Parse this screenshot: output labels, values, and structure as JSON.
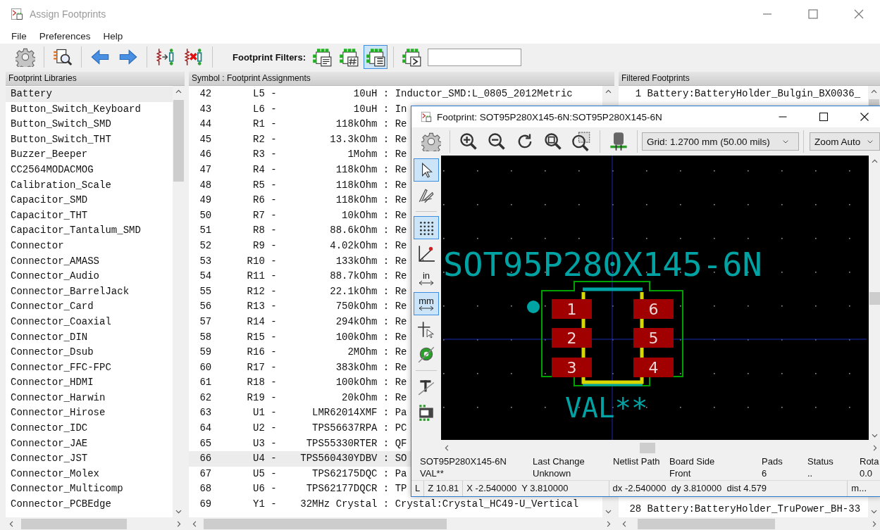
{
  "main_window": {
    "title": "Assign Footprints"
  },
  "menu": [
    "File",
    "Preferences",
    "Help"
  ],
  "toolbar": {
    "filters_label": "Footprint Filters:",
    "filters": [
      {
        "kind": "description",
        "selected": false
      },
      {
        "kind": "pin_count",
        "selected": false
      },
      {
        "kind": "library",
        "selected": true
      },
      {
        "kind": "text",
        "selected": false
      }
    ]
  },
  "libraries": {
    "header": "Footprint Libraries",
    "items": [
      {
        "name": "Battery",
        "selected": true
      },
      {
        "name": "Button_Switch_Keyboard",
        "selected": false
      },
      {
        "name": "Button_Switch_SMD",
        "selected": false
      },
      {
        "name": "Button_Switch_THT",
        "selected": false
      },
      {
        "name": "Buzzer_Beeper",
        "selected": false
      },
      {
        "name": "CC2564MODACMOG",
        "selected": false
      },
      {
        "name": "Calibration_Scale",
        "selected": false
      },
      {
        "name": "Capacitor_SMD",
        "selected": false
      },
      {
        "name": "Capacitor_THT",
        "selected": false
      },
      {
        "name": "Capacitor_Tantalum_SMD",
        "selected": false
      },
      {
        "name": "Connector",
        "selected": false
      },
      {
        "name": "Connector_AMASS",
        "selected": false
      },
      {
        "name": "Connector_Audio",
        "selected": false
      },
      {
        "name": "Connector_BarrelJack",
        "selected": false
      },
      {
        "name": "Connector_Card",
        "selected": false
      },
      {
        "name": "Connector_Coaxial",
        "selected": false
      },
      {
        "name": "Connector_DIN",
        "selected": false
      },
      {
        "name": "Connector_Dsub",
        "selected": false
      },
      {
        "name": "Connector_FFC-FPC",
        "selected": false
      },
      {
        "name": "Connector_HDMI",
        "selected": false
      },
      {
        "name": "Connector_Harwin",
        "selected": false
      },
      {
        "name": "Connector_Hirose",
        "selected": false
      },
      {
        "name": "Connector_IDC",
        "selected": false
      },
      {
        "name": "Connector_JAE",
        "selected": false
      },
      {
        "name": "Connector_JST",
        "selected": false
      },
      {
        "name": "Connector_Molex",
        "selected": false
      },
      {
        "name": "Connector_Multicomp",
        "selected": false
      },
      {
        "name": "Connector_PCBEdge",
        "selected": false
      }
    ]
  },
  "assignments": {
    "header": "Symbol : Footprint Assignments",
    "rows": [
      {
        "text": " 42       L5 -             10uH : Inductor_SMD:L_0805_2012Metric",
        "selected": false
      },
      {
        "text": " 43       L6 -             10uH : In",
        "selected": false
      },
      {
        "text": " 44       R1 -          118kOhm : Re",
        "selected": false
      },
      {
        "text": " 45       R2 -         13.3kOhm : Re",
        "selected": false
      },
      {
        "text": " 46       R3 -            1Mohm : Re",
        "selected": false
      },
      {
        "text": " 47       R4 -          118kOhm : Re",
        "selected": false
      },
      {
        "text": " 48       R5 -          118kOhm : Re",
        "selected": false
      },
      {
        "text": " 49       R6 -          118kOhm : Re",
        "selected": false
      },
      {
        "text": " 50       R7 -           10kOhm : Re",
        "selected": false
      },
      {
        "text": " 51       R8 -         88.6kOhm : Re",
        "selected": false
      },
      {
        "text": " 52       R9 -         4.02kOhm : Re",
        "selected": false
      },
      {
        "text": " 53      R10 -          133kOhm : Re",
        "selected": false
      },
      {
        "text": " 54      R11 -         88.7kOhm : Re",
        "selected": false
      },
      {
        "text": " 55      R12 -         22.1kOhm : Re",
        "selected": false
      },
      {
        "text": " 56      R13 -          750kOhm : Re",
        "selected": false
      },
      {
        "text": " 57      R14 -          294kOhm : Re",
        "selected": false
      },
      {
        "text": " 58      R15 -          100kOhm : Re",
        "selected": false
      },
      {
        "text": " 59      R16 -            2MOhm : Re",
        "selected": false
      },
      {
        "text": " 60      R17 -          383kOhm : Re",
        "selected": false
      },
      {
        "text": " 61      R18 -          100kOhm : Re",
        "selected": false
      },
      {
        "text": " 62      R19 -           20kOhm : Re",
        "selected": false
      },
      {
        "text": " 63       U1 -      LMR62014XMF : Pa",
        "selected": false
      },
      {
        "text": " 64       U2 -      TPS56637RPA : PC",
        "selected": false
      },
      {
        "text": " 65       U3 -     TPS55330RTER : QF",
        "selected": false
      },
      {
        "text": " 66       U4 -    TPS560430YDBV : SO",
        "selected": true
      },
      {
        "text": " 67       U5 -      TPS62175DQC : Pa",
        "selected": false
      },
      {
        "text": " 68       U6 -     TPS62177DQCR : TP",
        "selected": false
      },
      {
        "text": " 69       Y1 -    32MHz Crystal : Crystal:Crystal_HC49-U_Vertical",
        "selected": false
      }
    ]
  },
  "filtered": {
    "header": "Filtered Footprints",
    "items": [
      "  1 Battery:BatteryHolder_Bulgin_BX0036_",
      " 28 Battery:BatteryHolder_TruPower_BH-33"
    ]
  },
  "footprint_viewer": {
    "title": "Footprint: SOT95P280X145-6N:SOT95P280X145-6N",
    "grid_select": "Grid: 1.2700 mm (50.00 mils)",
    "zoom_select": "Zoom Auto",
    "tools": [
      {
        "kind": "select",
        "selected": true
      },
      {
        "kind": "measure",
        "selected": false
      },
      {
        "kind": "grid",
        "selected": true
      },
      {
        "kind": "polar",
        "selected": false
      },
      {
        "kind": "units",
        "label": "in",
        "selected": false
      },
      {
        "kind": "units",
        "label": "mm",
        "selected": true
      },
      {
        "kind": "cursor",
        "selected": false
      },
      {
        "kind": "pad",
        "selected": false
      },
      {
        "kind": "text",
        "selected": false
      },
      {
        "kind": "module",
        "selected": false
      }
    ],
    "canvas": {
      "reference": "SOT95P280X145-6N",
      "value": "VAL**",
      "pads": [
        "1",
        "2",
        "3",
        "6",
        "5",
        "4"
      ]
    },
    "info": [
      {
        "title": "SOT95P280X145-6N",
        "value": "VAL**"
      },
      {
        "title": "Last Change",
        "value": "Unknown"
      },
      {
        "title": "Netlist Path"
      },
      {
        "title": "Board Side",
        "value": "Front"
      },
      {
        "title": "Pads",
        "value": "6"
      },
      {
        "title": "Status",
        "value": ".."
      },
      {
        "title": "Rota",
        "value": "0.0"
      }
    ],
    "status": [
      "L",
      "Z 10.81",
      "X -2.540000  Y 3.810000",
      "dx -2.540000  dy 3.810000  dist 4.579",
      "m..."
    ]
  }
}
